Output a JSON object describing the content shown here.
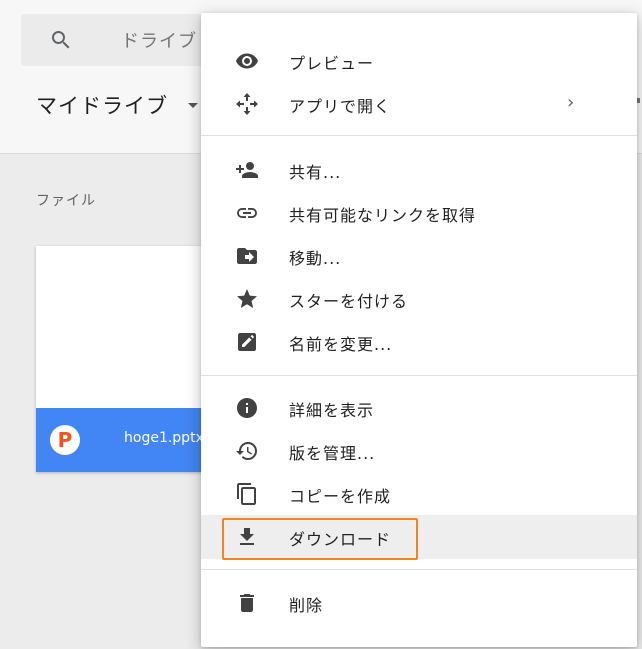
{
  "search": {
    "text": "ドライブ"
  },
  "drive": {
    "title": "マイドライブ"
  },
  "files": {
    "section_label": "ファイル",
    "items": [
      {
        "name": "hoge1.pptx",
        "type_letter": "P"
      }
    ]
  },
  "context_menu": {
    "group1": [
      {
        "label": "プレビュー",
        "icon": "eye-icon"
      },
      {
        "label": "アプリで開く",
        "icon": "move-arrows-icon",
        "chevron": "›"
      }
    ],
    "group2": [
      {
        "label": "共有...",
        "icon": "person-add-icon"
      },
      {
        "label": "共有可能なリンクを取得",
        "icon": "link-icon"
      },
      {
        "label": "移動...",
        "icon": "folder-move-icon"
      },
      {
        "label": "スターを付ける",
        "icon": "star-icon"
      },
      {
        "label": "名前を変更...",
        "icon": "rename-icon"
      }
    ],
    "group3": [
      {
        "label": "詳細を表示",
        "icon": "info-icon"
      },
      {
        "label": "版を管理...",
        "icon": "history-icon"
      },
      {
        "label": "コピーを作成",
        "icon": "copy-icon"
      },
      {
        "label": "ダウンロード",
        "icon": "download-icon"
      }
    ],
    "group4": [
      {
        "label": "削除",
        "icon": "trash-icon"
      }
    ]
  },
  "colors": {
    "accent": "#4285f4",
    "highlight_border": "#f0861f",
    "file_icon": "#f4511e"
  }
}
